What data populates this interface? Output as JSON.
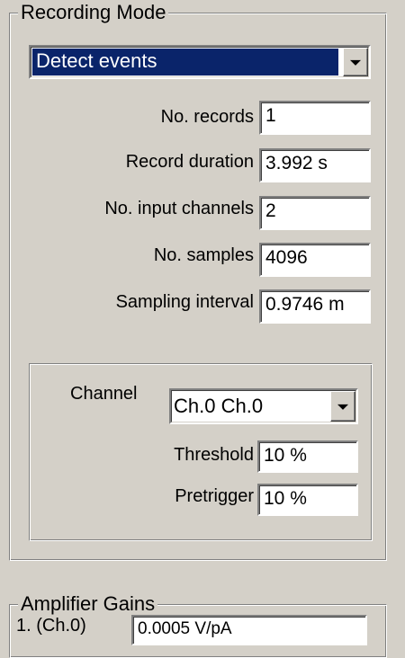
{
  "recording_mode": {
    "legend": "Recording Mode",
    "mode_selected": "Detect events",
    "fields": [
      {
        "label": "No. records",
        "value": "1"
      },
      {
        "label": "Record duration",
        "value": "3.992 s"
      },
      {
        "label": "No. input channels",
        "value": "2"
      },
      {
        "label": "No. samples",
        "value": "4096"
      },
      {
        "label": "Sampling interval",
        "value": "0.9746 m"
      }
    ],
    "event_detect": {
      "channel_label": "Channel",
      "channel_selected": "Ch.0 Ch.0",
      "threshold_label": "Threshold",
      "threshold_value": "10 %",
      "pretrigger_label": "Pretrigger",
      "pretrigger_value": "10 %"
    }
  },
  "amplifier_gains": {
    "legend": "Amplifier Gains",
    "channels": [
      {
        "label": "1. (Ch.0)",
        "value": "0.0005 V/pA"
      }
    ]
  },
  "colors": {
    "background": "#d4d0c8",
    "selection": "#0a246a",
    "field_bg": "#ffffff"
  }
}
